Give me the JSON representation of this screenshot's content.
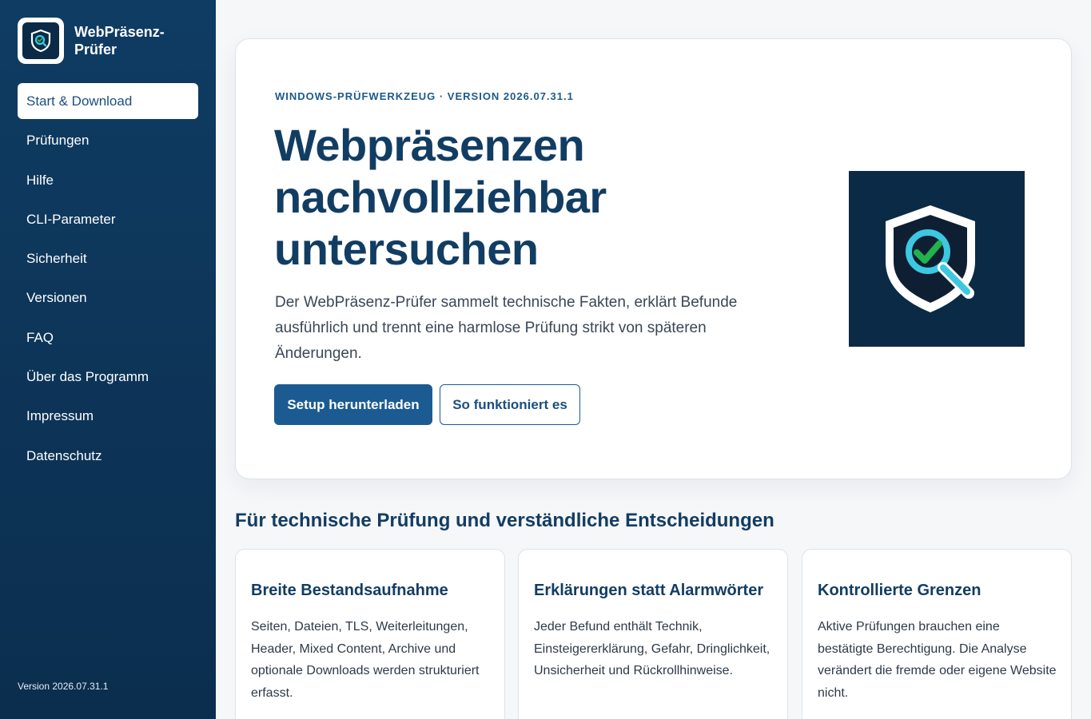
{
  "brand": {
    "name": "WebPräsenz-Prüfer",
    "logo_icon": "shield-search-icon"
  },
  "nav": {
    "items": [
      {
        "label": "Start & Download",
        "active": true
      },
      {
        "label": "Prüfungen"
      },
      {
        "label": "Hilfe"
      },
      {
        "label": "CLI-Parameter"
      },
      {
        "label": "Sicherheit"
      },
      {
        "label": "Versionen"
      },
      {
        "label": "FAQ"
      },
      {
        "label": "Über das Programm"
      },
      {
        "label": "Impressum"
      },
      {
        "label": "Datenschutz"
      }
    ]
  },
  "sidebar": {
    "version": "Version 2026.07.31.1"
  },
  "hero": {
    "eyebrow": "WINDOWS-PRÜFWERKZEUG · VERSION 2026.07.31.1",
    "title": "Webpräsenzen nachvollziehbar untersuchen",
    "description": "Der WebPräsenz-Prüfer sammelt technische Fakten, erklärt Befunde ausführlich und trennt eine harmlose Prüfung strikt von späteren Änderungen.",
    "primary_button": "Setup herunterladen",
    "secondary_button": "So funktioniert es",
    "art_icon": "shield-magnifier-check-icon"
  },
  "features": {
    "title": "Für technische Prüfung und verständliche Entscheidungen",
    "cards": [
      {
        "title": "Breite Bestandsaufnahme",
        "text": "Seiten, Dateien, TLS, Weiterleitungen, Header, Mixed Content, Archive und optionale Downloads werden strukturiert erfasst."
      },
      {
        "title": "Erklärungen statt Alarmwörter",
        "text": "Jeder Befund enthält Technik, Einsteigererklärung, Gefahr, Dringlichkeit, Unsicherheit und Rückrollhinweise."
      },
      {
        "title": "Kontrollierte Grenzen",
        "text": "Aktive Prüfungen brauchen eine bestätigte Berechtigung. Die Analyse verändert die fremde oder eigene Website nicht."
      }
    ]
  },
  "colors": {
    "sidebar": "#0f3c63",
    "accent": "#1b5b92",
    "heading": "#123d63",
    "art_bg": "#0b2a45",
    "check": "#22b14c",
    "lens": "#3cc8e0"
  }
}
